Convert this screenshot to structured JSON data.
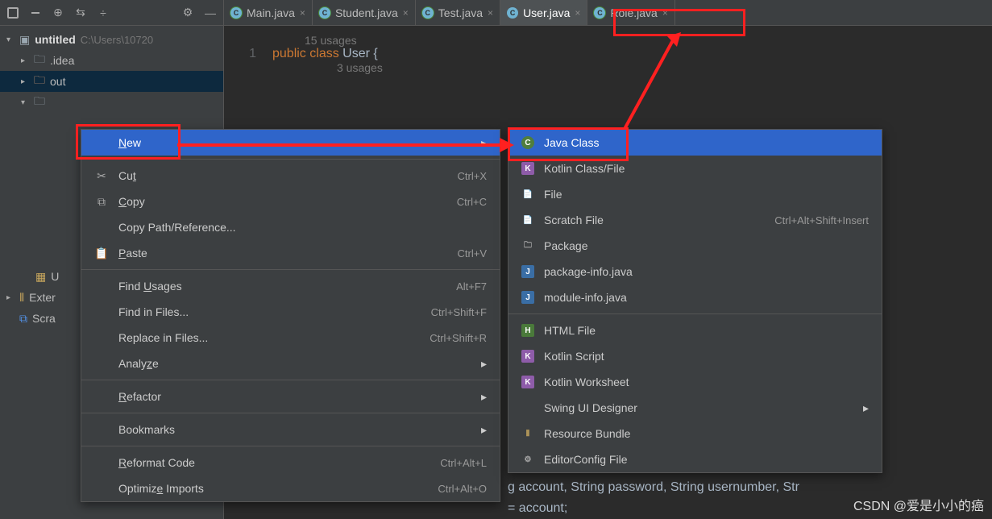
{
  "tree": {
    "root_label": "untitled",
    "root_path": "C:\\Users\\10720",
    "idea_folder": ".idea",
    "out_folder": "out",
    "external_libs": "Exter",
    "scratch": "Scra",
    "u_item": "U"
  },
  "tabs": {
    "main": "Main.java",
    "student": "Student.java",
    "test": "Test.java",
    "user": "User.java",
    "role": "Role.java"
  },
  "code": {
    "usages15": "15 usages",
    "line1_num": "1",
    "public": "public",
    "class": "class",
    "classname": "User",
    "usages3": "3 usages"
  },
  "menu1": {
    "new": "New",
    "cut": "Cut",
    "cut_sc": "Ctrl+X",
    "copy": "Copy",
    "copy_sc": "Ctrl+C",
    "copypath": "Copy Path/Reference...",
    "paste": "Paste",
    "paste_sc": "Ctrl+V",
    "findusages": "Find Usages",
    "findusages_sc": "Alt+F7",
    "findfiles": "Find in Files...",
    "findfiles_sc": "Ctrl+Shift+F",
    "replacefiles": "Replace in Files...",
    "replacefiles_sc": "Ctrl+Shift+R",
    "analyze": "Analyze",
    "refactor": "Refactor",
    "bookmarks": "Bookmarks",
    "reformat": "Reformat Code",
    "reformat_sc": "Ctrl+Alt+L",
    "optimize": "Optimize Imports",
    "optimize_sc": "Ctrl+Alt+O"
  },
  "menu2": {
    "javaclass": "Java Class",
    "kotlinclass": "Kotlin Class/File",
    "file": "File",
    "scratch": "Scratch File",
    "scratch_sc": "Ctrl+Alt+Shift+Insert",
    "package": "Package",
    "pkginfo": "package-info.java",
    "modinfo": "module-info.java",
    "html": "HTML File",
    "kotlinscript": "Kotlin Script",
    "kotlinws": "Kotlin Worksheet",
    "swing": "Swing UI Designer",
    "resource": "Resource Bundle",
    "editorconfig": "EditorConfig File"
  },
  "bottom": {
    "line1": "g account, String password, String usernumber, Str",
    "line2": "= account;"
  },
  "watermark": "CSDN @爱是小小的癌"
}
